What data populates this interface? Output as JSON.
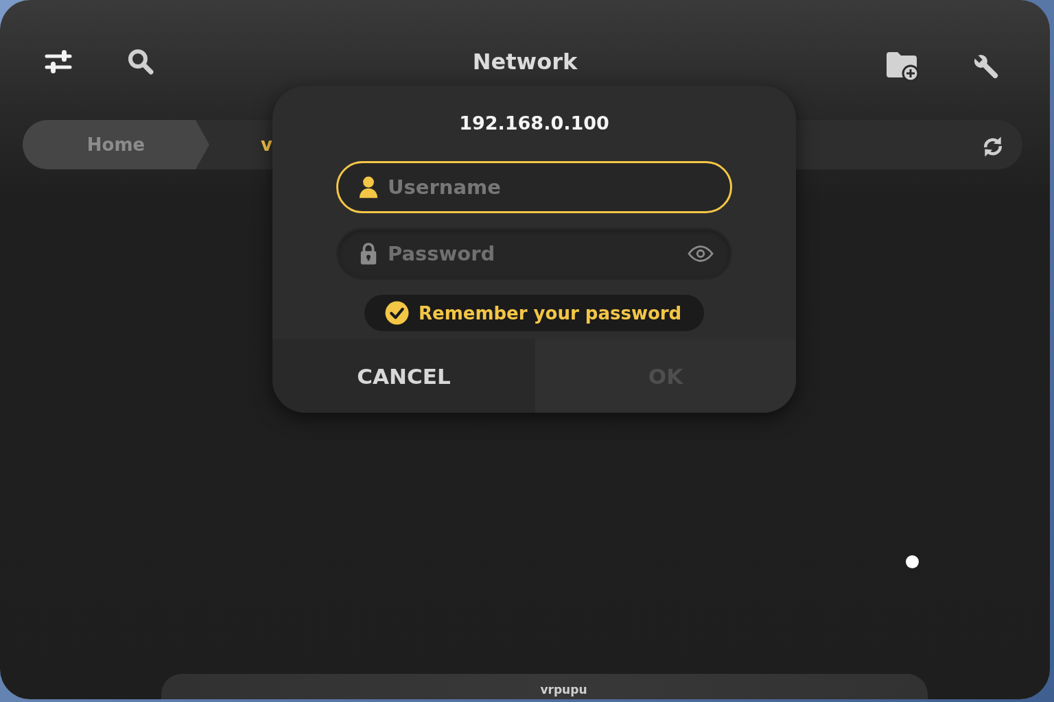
{
  "header": {
    "title": "Network"
  },
  "breadcrumb": [
    {
      "label": "Home",
      "selected": false
    },
    {
      "label": "v",
      "selected": true
    }
  ],
  "dialog": {
    "title": "192.168.0.100",
    "username": {
      "placeholder": "Username",
      "focused": true
    },
    "password": {
      "placeholder": "Password"
    },
    "remember": {
      "label": "Remember your password",
      "checked": true
    },
    "buttons": [
      {
        "label": "CANCEL",
        "disabled": false
      },
      {
        "label": "OK",
        "disabled": true
      }
    ]
  },
  "bottom_bar": {
    "label": "vrpupu"
  }
}
